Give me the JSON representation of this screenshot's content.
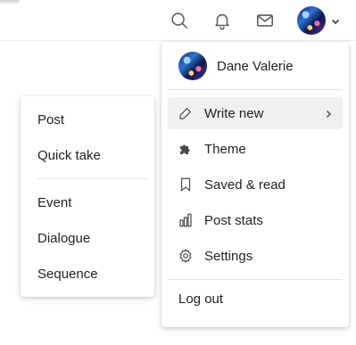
{
  "topbar": {
    "icons": [
      "search-icon",
      "bell-icon",
      "mail-icon",
      "chevron-down-icon"
    ]
  },
  "user_menu": {
    "user_name": "Dane Valerie",
    "items": [
      {
        "label": "Write new",
        "icon": "pencil-icon",
        "submenu": true
      },
      {
        "label": "Theme",
        "icon": "puzzle-icon"
      },
      {
        "label": "Saved & read",
        "icon": "bookmark-icon"
      },
      {
        "label": "Post stats",
        "icon": "bar-chart-icon"
      },
      {
        "label": "Settings",
        "icon": "gear-icon"
      }
    ],
    "logout_label": "Log out"
  },
  "write_submenu": {
    "group1": [
      "Post",
      "Quick take"
    ],
    "group2": [
      "Event",
      "Dialogue",
      "Sequence"
    ]
  },
  "colors": {
    "hover_bg": "#f0f0f0",
    "icon_gray": "#5c5c5c",
    "text": "#222222"
  }
}
